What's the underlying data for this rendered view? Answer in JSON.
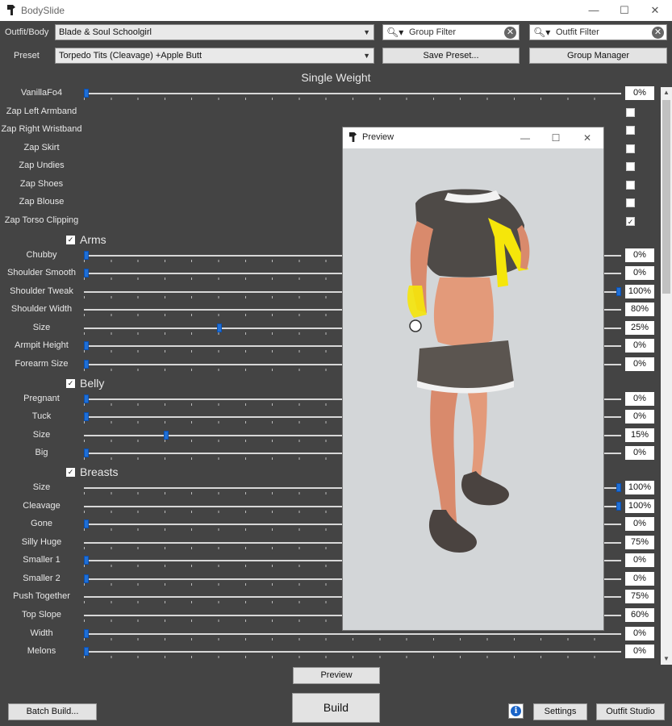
{
  "window": {
    "title": "BodySlide",
    "minimize": "—",
    "maximize": "☐",
    "close": "✕"
  },
  "top": {
    "outfit_label": "Outfit/Body",
    "outfit_value": "Blade & Soul Schoolgirl",
    "preset_label": "Preset",
    "preset_value": "Torpedo Tits (Cleavage) +Apple Butt",
    "group_filter_placeholder": "Group Filter",
    "outfit_filter_placeholder": "Outfit Filter",
    "save_preset": "Save Preset...",
    "group_manager": "Group Manager"
  },
  "heading": "Single Weight",
  "sliders": {
    "vanilla": {
      "label": "VanillaFo4",
      "value": "0%",
      "pos": 0
    },
    "zap": [
      {
        "label": "Zap Left Armband",
        "checked": ""
      },
      {
        "label": "Zap Right Wristband",
        "checked": ""
      },
      {
        "label": "Zap Skirt",
        "checked": ""
      },
      {
        "label": "Zap Undies",
        "checked": ""
      },
      {
        "label": "Zap Shoes",
        "checked": ""
      },
      {
        "label": "Zap Blouse",
        "checked": ""
      },
      {
        "label": "Zap Torso Clipping",
        "checked": "✓"
      }
    ],
    "arms_title": "Arms",
    "arms": [
      {
        "label": "Chubby",
        "value": "0%",
        "pos": 0
      },
      {
        "label": "Shoulder Smooth",
        "value": "0%",
        "pos": 0
      },
      {
        "label": "Shoulder Tweak",
        "value": "100%",
        "pos": 1
      },
      {
        "label": "Shoulder Width",
        "value": "80%",
        "pos": 0.8
      },
      {
        "label": "Size",
        "value": "25%",
        "pos": 0.25
      },
      {
        "label": "Armpit Height",
        "value": "0%",
        "pos": 0
      },
      {
        "label": "Forearm Size",
        "value": "0%",
        "pos": 0
      }
    ],
    "belly_title": "Belly",
    "belly": [
      {
        "label": "Pregnant",
        "value": "0%",
        "pos": 0
      },
      {
        "label": "Tuck",
        "value": "0%",
        "pos": 0
      },
      {
        "label": "Size",
        "value": "15%",
        "pos": 0.15
      },
      {
        "label": "Big",
        "value": "0%",
        "pos": 0
      }
    ],
    "breasts_title": "Breasts",
    "breasts": [
      {
        "label": "Size",
        "value": "100%",
        "pos": 1
      },
      {
        "label": "Cleavage",
        "value": "100%",
        "pos": 1
      },
      {
        "label": "Gone",
        "value": "0%",
        "pos": 0
      },
      {
        "label": "Silly Huge",
        "value": "75%",
        "pos": 0.75
      },
      {
        "label": "Smaller 1",
        "value": "0%",
        "pos": 0
      },
      {
        "label": "Smaller 2",
        "value": "0%",
        "pos": 0
      },
      {
        "label": "Push Together",
        "value": "75%",
        "pos": 0.75
      },
      {
        "label": "Top Slope",
        "value": "60%",
        "pos": 0.6
      },
      {
        "label": "Width",
        "value": "0%",
        "pos": 0
      },
      {
        "label": "Melons",
        "value": "0%",
        "pos": 0
      }
    ]
  },
  "preview_window": {
    "title": "Preview"
  },
  "bottom": {
    "preview": "Preview",
    "build": "Build",
    "batch_build": "Batch Build...",
    "info": "i",
    "settings": "Settings",
    "outfit_studio": "Outfit Studio"
  }
}
